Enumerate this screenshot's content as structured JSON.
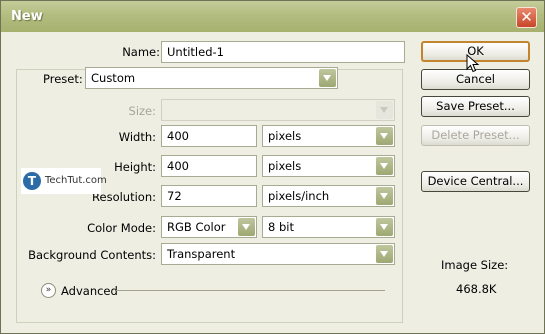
{
  "window": {
    "title": "New",
    "close_glyph": "✕"
  },
  "form": {
    "name_label": "Name:",
    "name_value": "Untitled-1",
    "preset_label": "Preset:",
    "preset_value": "Custom",
    "size_label": "Size:",
    "size_value": "",
    "width_label": "Width:",
    "width_value": "400",
    "width_unit": "pixels",
    "height_label": "Height:",
    "height_value": "400",
    "height_unit": "pixels",
    "resolution_label": "Resolution:",
    "resolution_value": "72",
    "resolution_unit": "pixels/inch",
    "color_mode_label": "Color Mode:",
    "color_mode_value": "RGB Color",
    "bit_depth_value": "8 bit",
    "background_label": "Background Contents:",
    "background_value": "Transparent",
    "advanced_label": "Advanced",
    "advanced_glyph": "»"
  },
  "buttons": {
    "ok": "OK",
    "cancel": "Cancel",
    "save_preset": "Save Preset...",
    "delete_preset": "Delete Preset...",
    "device_central": "Device Central..."
  },
  "info": {
    "image_size_label": "Image Size:",
    "image_size_value": "468.8K"
  },
  "watermark": {
    "logo_letter": "T",
    "text": "TechTut.com"
  },
  "colors": {
    "titlebar": "#b3bd80",
    "dialog_bg": "#eeeee3",
    "default_button_border": "#c2852e",
    "dropdown_arrow": "#9ea872"
  }
}
